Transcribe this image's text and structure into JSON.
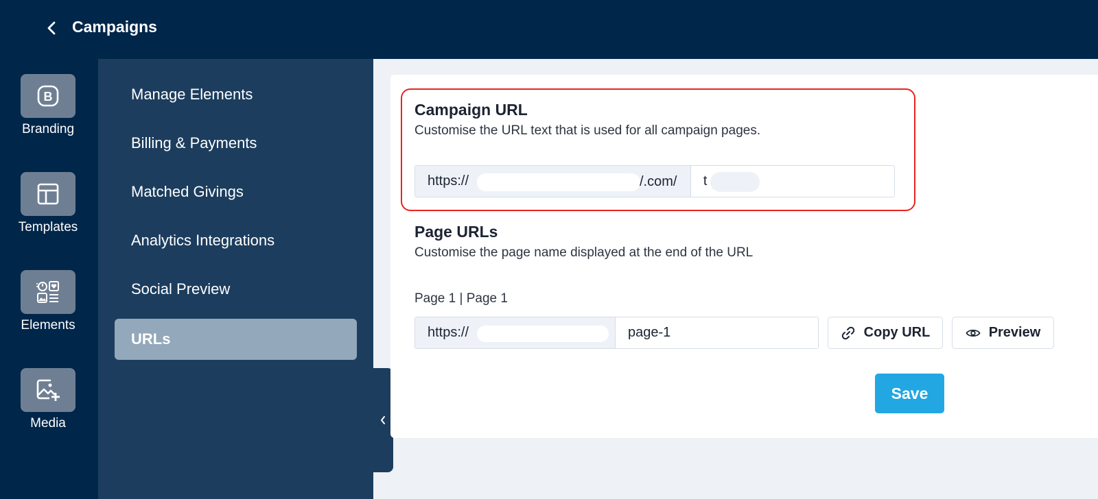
{
  "header": {
    "title": "Campaigns"
  },
  "rail": {
    "items": [
      {
        "label": "Branding",
        "icon": "branding-icon"
      },
      {
        "label": "Templates",
        "icon": "templates-icon"
      },
      {
        "label": "Elements",
        "icon": "elements-icon"
      },
      {
        "label": "Media",
        "icon": "media-icon"
      }
    ]
  },
  "submenu": {
    "items": [
      {
        "label": "Manage Elements"
      },
      {
        "label": "Billing & Payments"
      },
      {
        "label": "Matched Givings"
      },
      {
        "label": "Analytics Integrations"
      },
      {
        "label": "Social Preview"
      },
      {
        "label": "URLs",
        "active": true
      }
    ]
  },
  "campaign_url": {
    "title": "Campaign URL",
    "description": "Customise the URL text that is used for all campaign pages.",
    "prefix_start": "https://",
    "prefix_end": "/.com/",
    "value": "t"
  },
  "page_urls": {
    "title": "Page URLs",
    "description": "Customise the page name displayed at the end of the URL",
    "page_label": "Page 1 | Page 1",
    "prefix_start": "https://",
    "value": "page-1",
    "copy_label": "Copy URL",
    "preview_label": "Preview"
  },
  "actions": {
    "save_label": "Save"
  },
  "colors": {
    "topbar": "#00264a",
    "submenu": "#1c3d5e",
    "active_item": "#93a8ba",
    "save_button": "#22a7e2",
    "highlight": "#e8231f"
  }
}
